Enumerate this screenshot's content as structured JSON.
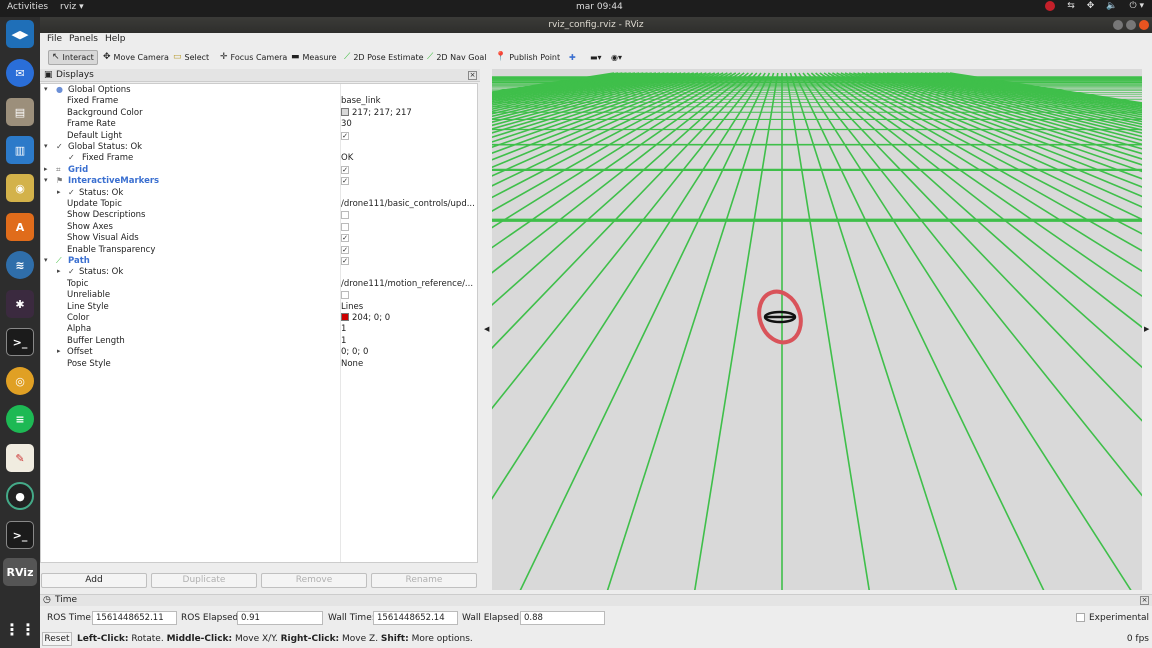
{
  "topbar": {
    "activities": "Activities",
    "app_menu": "rviz",
    "clock": "mar 09:44"
  },
  "window": {
    "title": "rviz_config.rviz - RViz"
  },
  "menu": {
    "file": "File",
    "panels": "Panels",
    "help": "Help"
  },
  "toolbar": {
    "interact": "Interact",
    "move_camera": "Move Camera",
    "select": "Select",
    "focus_camera": "Focus Camera",
    "measure": "Measure",
    "pose_estimate": "2D Pose Estimate",
    "nav_goal": "2D Nav Goal",
    "publish_point": "Publish Point"
  },
  "displays": {
    "title": "Displays",
    "rows": [
      {
        "name": "Global Options",
        "value": ""
      },
      {
        "name": "Fixed Frame",
        "value": "base_link"
      },
      {
        "name": "Background Color",
        "value": "217; 217; 217"
      },
      {
        "name": "Frame Rate",
        "value": "30"
      },
      {
        "name": "Default Light",
        "value": "✓"
      },
      {
        "name": "Global Status: Ok",
        "value": ""
      },
      {
        "name": "Fixed Frame",
        "value": "OK"
      },
      {
        "name": "Grid",
        "value": "✓"
      },
      {
        "name": "InteractiveMarkers",
        "value": "✓"
      },
      {
        "name": "Status: Ok",
        "value": ""
      },
      {
        "name": "Update Topic",
        "value": "/drone111/basic_controls/upd..."
      },
      {
        "name": "Show Descriptions",
        "value": ""
      },
      {
        "name": "Show Axes",
        "value": ""
      },
      {
        "name": "Show Visual Aids",
        "value": "✓"
      },
      {
        "name": "Enable Transparency",
        "value": "✓"
      },
      {
        "name": "Path",
        "value": "✓"
      },
      {
        "name": "Status: Ok",
        "value": ""
      },
      {
        "name": "Topic",
        "value": "/drone111/motion_reference/..."
      },
      {
        "name": "Unreliable",
        "value": ""
      },
      {
        "name": "Line Style",
        "value": "Lines"
      },
      {
        "name": "Color",
        "value": "204; 0; 0"
      },
      {
        "name": "Alpha",
        "value": "1"
      },
      {
        "name": "Buffer Length",
        "value": "1"
      },
      {
        "name": "Offset",
        "value": "0; 0; 0"
      },
      {
        "name": "Pose Style",
        "value": "None"
      }
    ],
    "buttons": {
      "add": "Add",
      "duplicate": "Duplicate",
      "remove": "Remove",
      "rename": "Rename"
    }
  },
  "colors": {
    "background": "#d9d9d9",
    "path_color": "#cc0000",
    "grid": "#3fbf4a"
  },
  "time": {
    "title": "Time",
    "ros_time_label": "ROS Time:",
    "ros_time": "1561448652.11",
    "ros_elapsed_label": "ROS Elapsed:",
    "ros_elapsed": "0.91",
    "wall_time_label": "Wall Time:",
    "wall_time": "1561448652.14",
    "wall_elapsed_label": "Wall Elapsed:",
    "wall_elapsed": "0.88",
    "experimental": "Experimental"
  },
  "status": {
    "reset": "Reset",
    "left_click": "Left-Click:",
    "left_text": " Rotate. ",
    "middle_click": "Middle-Click:",
    "middle_text": " Move X/Y. ",
    "right_click": "Right-Click:",
    "right_text": " Move Z. ",
    "shift": "Shift:",
    "shift_text": " More options.",
    "fps": "0 fps"
  }
}
